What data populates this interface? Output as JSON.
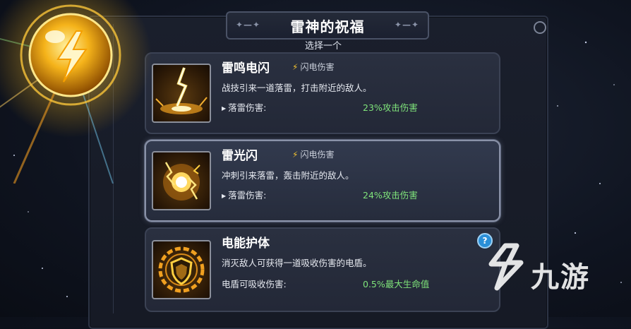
{
  "title": "雷神的祝福",
  "subtitle": "选择一个",
  "cards": [
    {
      "name": "雷鸣电闪",
      "tag": "闪电伤害",
      "description": "战技引来一道落雷，打击附近的敌人。",
      "stat_label": "落雷伤害:",
      "stat_value": "23%攻击伤害",
      "icon": "lightning-strike-icon"
    },
    {
      "name": "雷光闪",
      "tag": "闪电伤害",
      "description": "冲刺引来落雷，轰击附近的敌人。",
      "stat_label": "落雷伤害:",
      "stat_value": "24%攻击伤害",
      "icon": "lightning-orb-icon",
      "selected": true
    },
    {
      "name": "电能护体",
      "description": "消灭敌人可获得一道吸收伤害的电盾。",
      "stat_label": "电盾可吸收伤害:",
      "stat_value": "0.5%最大生命值",
      "icon": "lightning-shield-icon"
    }
  ],
  "help_label": "?",
  "watermark": "九游",
  "colors": {
    "accent_gold": "#f2c230",
    "stat_green": "#7fe37a",
    "help_blue": "#2a8fd8"
  }
}
